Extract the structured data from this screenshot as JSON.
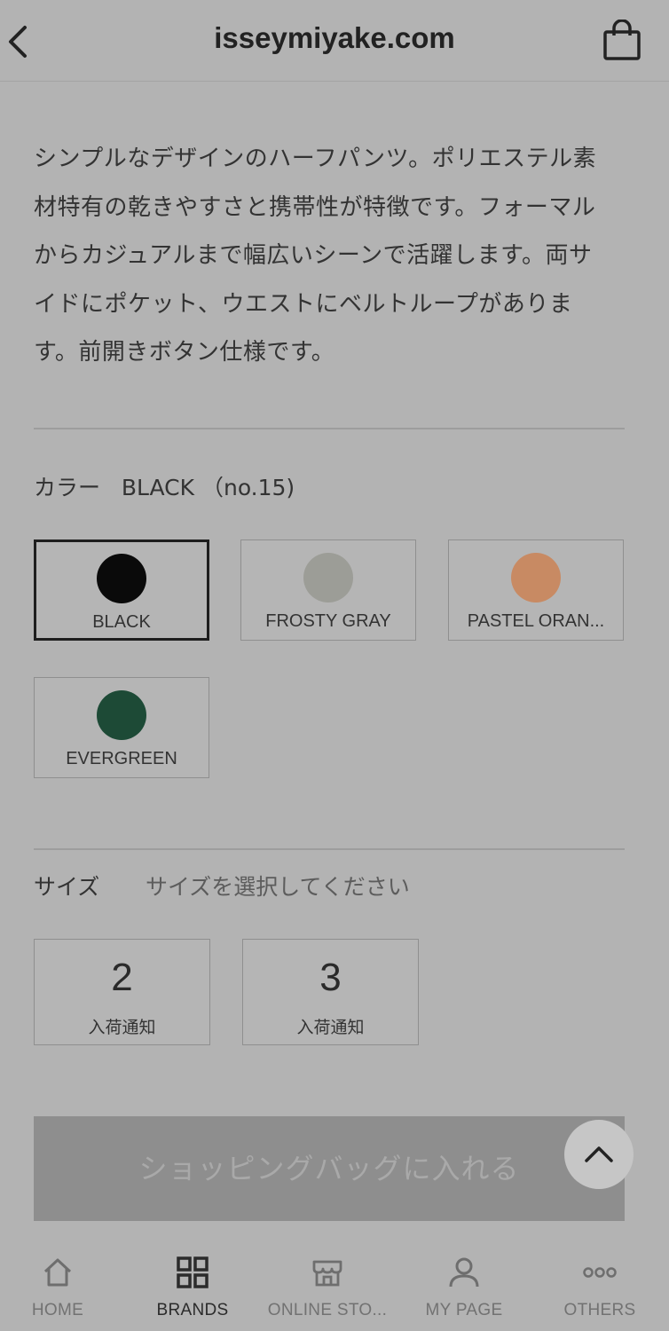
{
  "header": {
    "title": "isseymiyake.com",
    "back_icon": "chevron-left-icon",
    "bag_icon": "shopping-bag-icon"
  },
  "product": {
    "description_lines": [
      "シンプルなデザインのハーフパンツ。ポリエステル素",
      "材特有の乾きやすさと携帯性が特徴です。フォーマル",
      "からカジュアルまで幅広いシーンで活躍します。両サ",
      "イドにポケット、ウエストにベルトループがありま",
      "す。前開きボタン仕様です。"
    ]
  },
  "color": {
    "label": "カラー",
    "selected_value": "BLACK （no.15)",
    "options": [
      {
        "name": "BLACK",
        "swatch": "#0a0a0a",
        "selected": true
      },
      {
        "name": "FROSTY GRAY",
        "swatch": "#9c9d97",
        "selected": false
      },
      {
        "name": "PASTEL ORAN...",
        "swatch": "#c88a63",
        "selected": false
      },
      {
        "name": "EVERGREEN",
        "swatch": "#1d4a36",
        "selected": false
      }
    ]
  },
  "size": {
    "label": "サイズ",
    "hint": "サイズを選択してください",
    "options": [
      {
        "value": "2",
        "status": "入荷通知"
      },
      {
        "value": "3",
        "status": "入荷通知"
      }
    ]
  },
  "actions": {
    "add_to_bag": "ショッピングバッグに入れる",
    "scroll_top_icon": "chevron-up-icon"
  },
  "tabbar": {
    "items": [
      {
        "label": "HOME",
        "icon": "home-icon",
        "active": false
      },
      {
        "label": "BRANDS",
        "icon": "grid-icon",
        "active": true
      },
      {
        "label": "ONLINE STO...",
        "icon": "store-icon",
        "active": false
      },
      {
        "label": "MY PAGE",
        "icon": "user-icon",
        "active": false
      },
      {
        "label": "OTHERS",
        "icon": "more-icon",
        "active": false
      }
    ]
  }
}
